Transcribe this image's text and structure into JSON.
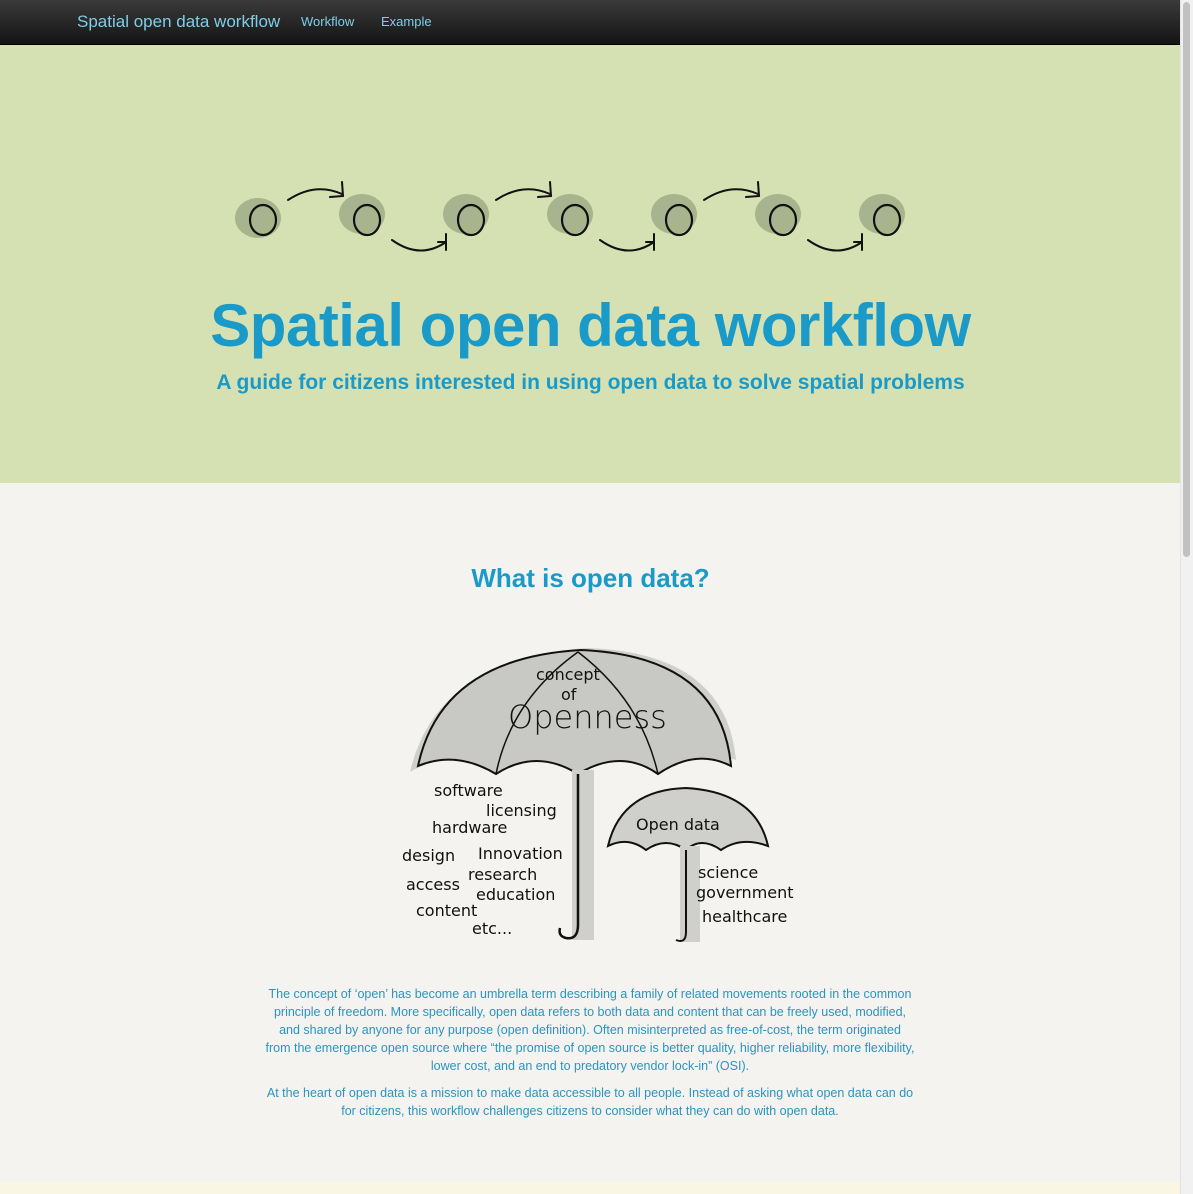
{
  "navbar": {
    "brand": "Spatial open data workflow",
    "links": [
      {
        "label": "Workflow"
      },
      {
        "label": "Example"
      }
    ]
  },
  "hero": {
    "workflow_icon": "workflow-circles-arrows-illustration",
    "title": "Spatial open data workflow",
    "subtitle": "A guide for citizens interested in using open data to solve spatial problems"
  },
  "open_data_section": {
    "title": "What is open data?",
    "illustration": {
      "icon": "umbrella-illustration",
      "big_umbrella": {
        "line1": "concept",
        "line2": "of",
        "line3": "Openness"
      },
      "small_umbrella": "Open data",
      "left_terms": [
        "software",
        "licensing",
        "hardware",
        "design",
        "Innovation",
        "research",
        "access",
        "education",
        "content",
        "etc..."
      ],
      "right_terms": [
        "science",
        "government",
        "healthcare"
      ]
    },
    "paragraphs": [
      "The concept of ‘open’ has become an umbrella term describing a family of related movements rooted in the common principle of freedom. More specifically, open data refers to both data and content that can be freely used, modified, and shared by anyone for any purpose (open definition). Often misinterpreted as free-of-cost, the term originated from the emergence open source where “the promise of open source is better quality, higher reliability, more flexibility, lower cost, and an end to predatory vendor lock-in” (OSI).",
      "At the heart of open data is a mission to make data accessible to all people. Instead of asking what open data can do for citizens, this workflow challenges citizens to consider what they can do with open data."
    ]
  },
  "colors": {
    "navbar_bg": "#1f1f1f",
    "nav_text": "#7fcde8",
    "hero_bg": "#d5e1b3",
    "accent": "#199ac9",
    "page_bg": "#f4f3ef"
  }
}
